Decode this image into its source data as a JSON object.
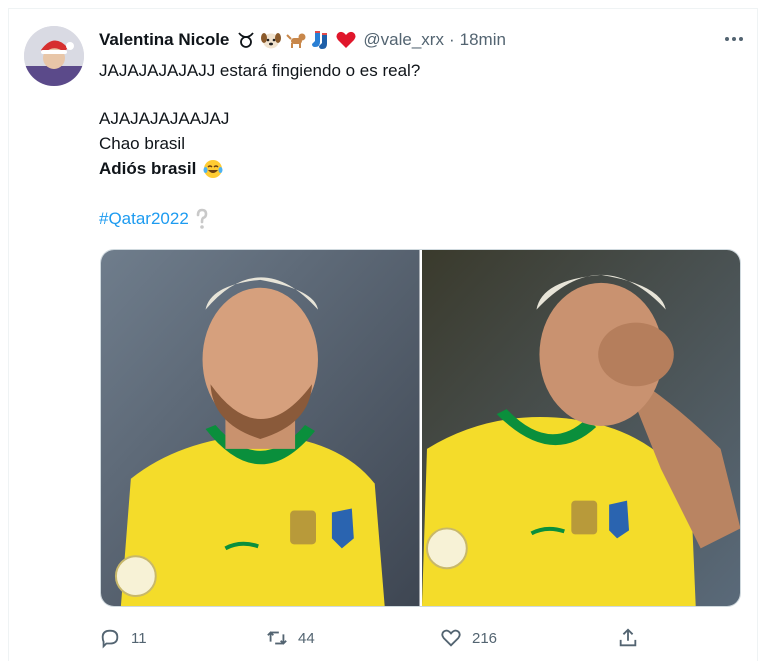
{
  "tweet": {
    "author_name": "Valentina Nicole",
    "handle": "@vale_xrx",
    "separator": "·",
    "time": "18min",
    "emojis": [
      "taurus-icon",
      "dog-face-icon",
      "dog-icon",
      "socks-icon",
      "red-heart-icon"
    ],
    "lines": {
      "line1": "JAJAJAJAJAJJ estará fingiendo o es real?",
      "line2": "AJAJAJAJAAJAJ",
      "line3": "Chao brasil",
      "line4": "Adiós brasil",
      "hashtag": "#Qatar2022"
    }
  },
  "actions": {
    "reply_count": "11",
    "retweet_count": "44",
    "like_count": "216"
  },
  "colors": {
    "hashtag": "#1d9bf0",
    "muted": "#536471",
    "jersey_yellow": "#f4dc2a",
    "jersey_green": "#0a8f3c"
  }
}
